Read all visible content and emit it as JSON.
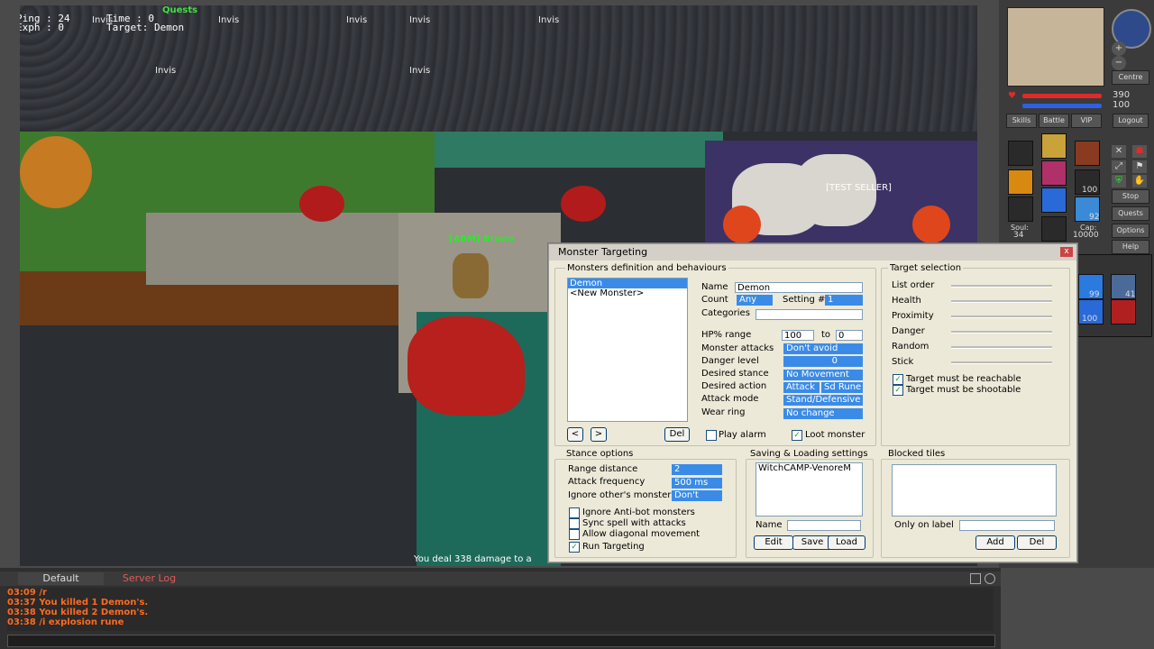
{
  "hud": {
    "ping": "Ping : 24",
    "time": "Time : 0",
    "exph": "Exph : 0",
    "target": "Target: Demon",
    "quests": "Quests",
    "invis": [
      "Invis",
      "Invis",
      "Invis",
      "Invis",
      "Invis",
      "Invis",
      "Invis"
    ],
    "player_name": "[ABM] Bruno",
    "npc_name": "[TEST SELLER]",
    "damage_msg": "You deal 338 damage to a"
  },
  "right_panel": {
    "centre": "Centre",
    "hp": "390",
    "mana": "100",
    "buttons": [
      "Skills",
      "Battle",
      "VIP",
      "Logout"
    ],
    "side_buttons": [
      "Stop",
      "Quests",
      "Options",
      "Help"
    ],
    "soul_label": "Soul:",
    "soul": "34",
    "cap_label": "Cap:",
    "cap": "10000",
    "counts": [
      "100",
      "92",
      "99",
      "41",
      "100"
    ],
    "colors": {
      "hp": "#e02a2a",
      "mana": "#3060e0"
    }
  },
  "dialog": {
    "title": "Monster Targeting",
    "close": "x",
    "monsters_group": "Monsters definition and behaviours",
    "monsters": [
      "Demon",
      "<New Monster>"
    ],
    "nav_prev": "<",
    "nav_next": ">",
    "del": "Del",
    "name_label": "Name",
    "name_value": "Demon",
    "count_label": "Count",
    "count_value": "Any",
    "setting_label": "Setting #",
    "setting_value": "1",
    "categories_label": "Categories",
    "hp_label": "HP% range",
    "hp_from": "100",
    "hp_to_label": "to",
    "hp_to": "0",
    "monster_attacks_label": "Monster attacks",
    "monster_attacks_value": "Don't avoid",
    "danger_label": "Danger level",
    "danger_value": "0",
    "stance_label": "Desired stance",
    "stance_value": "No Movement",
    "action_label": "Desired action",
    "action_value1": "Attack",
    "action_value2": "Sd Rune",
    "attack_mode_label": "Attack mode",
    "attack_mode_value": "Stand/Defensive",
    "wear_ring_label": "Wear ring",
    "wear_ring_value": "No change",
    "play_alarm": "Play alarm",
    "loot_monster": "Loot monster",
    "target_selection": "Target selection",
    "sliders": [
      "List order",
      "Health",
      "Proximity",
      "Danger",
      "Random",
      "Stick"
    ],
    "reachable": "Target must be reachable",
    "shootable": "Target must be shootable",
    "stance_options": "Stance options",
    "range_label": "Range distance",
    "range_value": "2",
    "freq_label": "Attack frequency",
    "freq_value": "500 ms",
    "ignore_label": "Ignore other's monsters",
    "ignore_value": "Don't",
    "checkboxes": [
      "Ignore Anti-bot monsters",
      "Sync spell with attacks",
      "Allow diagonal movement",
      "Run Targeting"
    ],
    "saving_group": "Saving & Loading settings",
    "saved_item": "WitchCAMP-VenoreM",
    "save_name_label": "Name",
    "edit": "Edit",
    "save": "Save",
    "load": "Load",
    "blocked_group": "Blocked tiles",
    "only_label": "Only on label",
    "add": "Add",
    "del2": "Del"
  },
  "chat": {
    "tabs": [
      "Default",
      "Server Log"
    ],
    "lines": [
      "03:09 /r",
      "03:37 You killed 1 Demon's.",
      "03:38 You killed 2 Demon's.",
      "03:38 /i explosion rune"
    ]
  }
}
